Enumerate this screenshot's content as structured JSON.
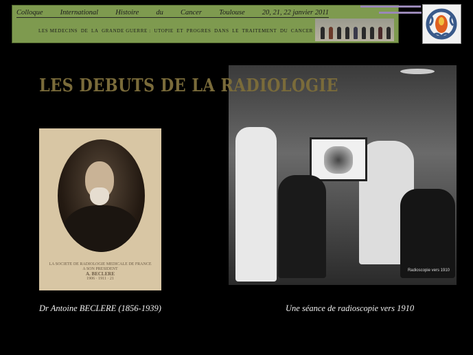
{
  "header": {
    "row1": [
      "Colloque",
      "International",
      "Histoire",
      "du",
      "Cancer",
      "Toulouse",
      "20, 21, 22 janvier 2011"
    ],
    "row2": [
      "LES MEDECINS",
      "DE",
      "LA",
      "GRANDE GUERRE :",
      "UTOPIE",
      "ET",
      "PROGRES",
      "DANS",
      "LE",
      "TRAITEMENT",
      "DU",
      "CANCER"
    ]
  },
  "title": "LES DEBUTS DE LA RADIOLOGIE",
  "portrait": {
    "caption_lines": [
      "LA SOCIETE DE RADIOLOGIE MEDICALE DE FRANCE",
      "A SON PRESIDENT",
      "A. BECLERE",
      "1906 · 1911 · 21"
    ]
  },
  "photo": {
    "caption": "Radioscopie vers 1910"
  },
  "captions": {
    "left": "Dr Antoine BECLERE  (1856-1939)",
    "right": "Une séance de radioscopie vers 1910"
  },
  "colors": {
    "banner": "#7e9a4f",
    "title": "#7a6b3a",
    "background": "#000000"
  }
}
